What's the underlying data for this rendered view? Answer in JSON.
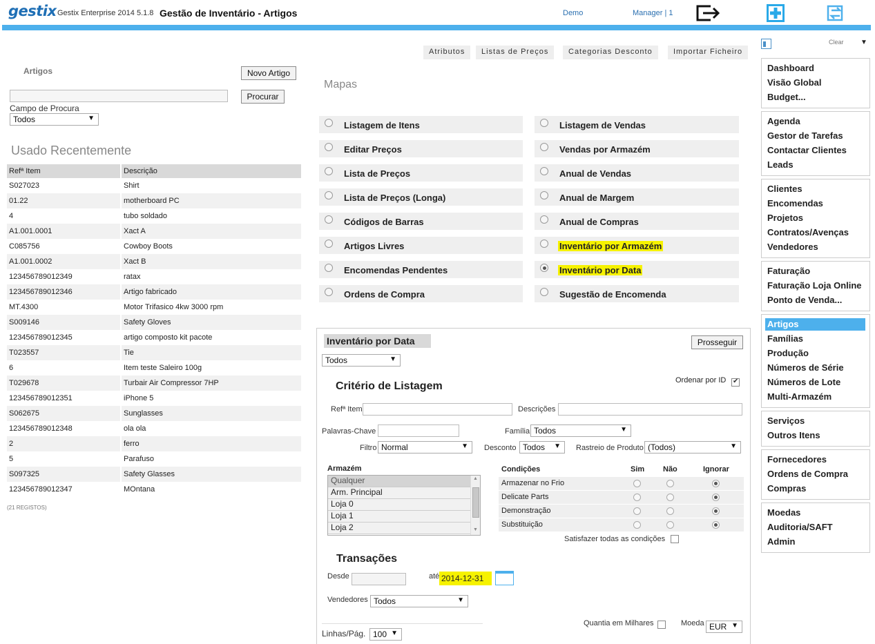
{
  "header": {
    "logo": "gestix",
    "product": "Gestix Enterprise 2014 5.1.8",
    "title": "Gestão de Inventário - Artigos",
    "demo": "Demo",
    "user": "Manager",
    "user_sep": " | ",
    "user_count": "1"
  },
  "tabs": [
    "Atributos",
    "Listas de Preços",
    "Categorias Desconto",
    "Importar Ficheiro"
  ],
  "left": {
    "artigos_label": "Artigos",
    "novo_artigo": "Novo Artigo",
    "search_value": "",
    "procurar": "Procurar",
    "campo_label": "Campo de Procura",
    "campo_value": "Todos",
    "recent_title": "Usado Recentemente",
    "columns": [
      "Refª Item",
      "Descrição"
    ],
    "rows": [
      [
        "S027023",
        "Shirt"
      ],
      [
        "01.22",
        "motherboard PC"
      ],
      [
        "4",
        "tubo soldado"
      ],
      [
        "A1.001.0001",
        "Xact A"
      ],
      [
        "C085756",
        "Cowboy Boots"
      ],
      [
        "A1.001.0002",
        "Xact B"
      ],
      [
        "123456789012349",
        "ratax"
      ],
      [
        "123456789012346",
        "Artigo fabricado"
      ],
      [
        "MT.4300",
        "Motor Trifasico 4kw 3000 rpm"
      ],
      [
        "S009146",
        "Safety Gloves"
      ],
      [
        "123456789012345",
        "artigo composto kit pacote"
      ],
      [
        "T023557",
        "Tie"
      ],
      [
        "6",
        "Item teste Saleiro 100g"
      ],
      [
        "T029678",
        "Turbair Air Compressor 7HP"
      ],
      [
        "123456789012351",
        "iPhone 5"
      ],
      [
        "S062675",
        "Sunglasses"
      ],
      [
        "123456789012348",
        "ola ola"
      ],
      [
        "2",
        "ferro"
      ],
      [
        "5",
        "Parafuso"
      ],
      [
        "S097325",
        "Safety Glasses"
      ],
      [
        "123456789012347",
        "MOntana"
      ]
    ],
    "count": "(21 REGISTOS)"
  },
  "mapas": {
    "title": "Mapas",
    "left_items": [
      "Listagem de Itens",
      "Editar Preços",
      "Lista de Preços",
      "Lista de Preços (Longa)",
      "Códigos de Barras",
      "Artigos Livres",
      "Encomendas Pendentes",
      "Ordens de Compra"
    ],
    "right_items": [
      "Listagem de Vendas",
      "Vendas por Armazém",
      "Anual de Vendas",
      "Anual de Margem",
      "Anual de Compras",
      "Inventário por Armazém",
      "Inventário por Data",
      "Sugestão de Encomenda"
    ],
    "selected": "Inventário por Data"
  },
  "report": {
    "title": "Inventário por Data",
    "prosseguir": "Prosseguir",
    "scope_value": "Todos",
    "criterio_title": "Critério de Listagem",
    "ordenar_label": "Ordenar por ID",
    "ordenar_checked": true,
    "ref_label": "Refª Item",
    "desc_label": "Descrições",
    "palavras_label": "Palavras-Chave",
    "familia_label": "Família",
    "familia_value": "Todos",
    "filtro_label": "Filtro",
    "filtro_value": "Normal",
    "desconto_label": "Desconto",
    "desconto_value": "Todos",
    "rastreio_label": "Rastreio de Produto",
    "rastreio_value": "(Todos)",
    "armazem_label": "Armazém",
    "armazem_items": [
      "Qualquer",
      "Arm. Principal",
      "Loja 0",
      "Loja 1",
      "Loja 2"
    ],
    "condicoes_label": "Condições",
    "sim": "Sim",
    "nao": "Não",
    "ignorar": "Ignorar",
    "condicoes": [
      "Armazenar no Frio",
      "Delicate Parts",
      "Demonstração",
      "Substituição"
    ],
    "satisfazer_label": "Satisfazer todas as condições",
    "transacoes_title": "Transações",
    "desde_label": "Desde",
    "desde_value": "",
    "ate_label": "até",
    "ate_value": "2014-12-31",
    "vendedores_label": "Vendedores",
    "vendedores_value": "Todos",
    "quantia_label": "Quantia em Milhares",
    "moeda_label": "Moeda",
    "moeda_value": "EUR",
    "linhas_label": "Linhas/Pág.",
    "linhas_value": "100"
  },
  "sidebar": {
    "clear": "Clear",
    "groups": [
      [
        "Dashboard",
        "Visão Global",
        "Budget..."
      ],
      [
        "Agenda",
        "Gestor de Tarefas",
        "Contactar Clientes",
        "Leads"
      ],
      [
        "Clientes",
        "Encomendas",
        "Projetos",
        "Contratos/Avenças",
        "Vendedores"
      ],
      [
        "Faturação",
        "Faturação Loja Online",
        "Ponto de Venda..."
      ],
      [
        "Artigos",
        "Famílias",
        "Produção",
        "Números de Série",
        "Números de Lote",
        "Multi-Armazém"
      ],
      [
        "Serviços",
        "Outros Itens"
      ],
      [
        "Fornecedores",
        "Ordens de Compra",
        "Compras"
      ],
      [
        "Moedas",
        "Auditoria/SAFT",
        "Admin"
      ]
    ],
    "active": "Artigos"
  },
  "colors": {
    "accent": "#4db0ec",
    "highlight": "#f6f200",
    "link": "#2a6fb0"
  },
  "icons": [
    "logout-icon",
    "plus-icon",
    "sync-icon",
    "calendar-icon",
    "sidebar-toggle-icon"
  ]
}
